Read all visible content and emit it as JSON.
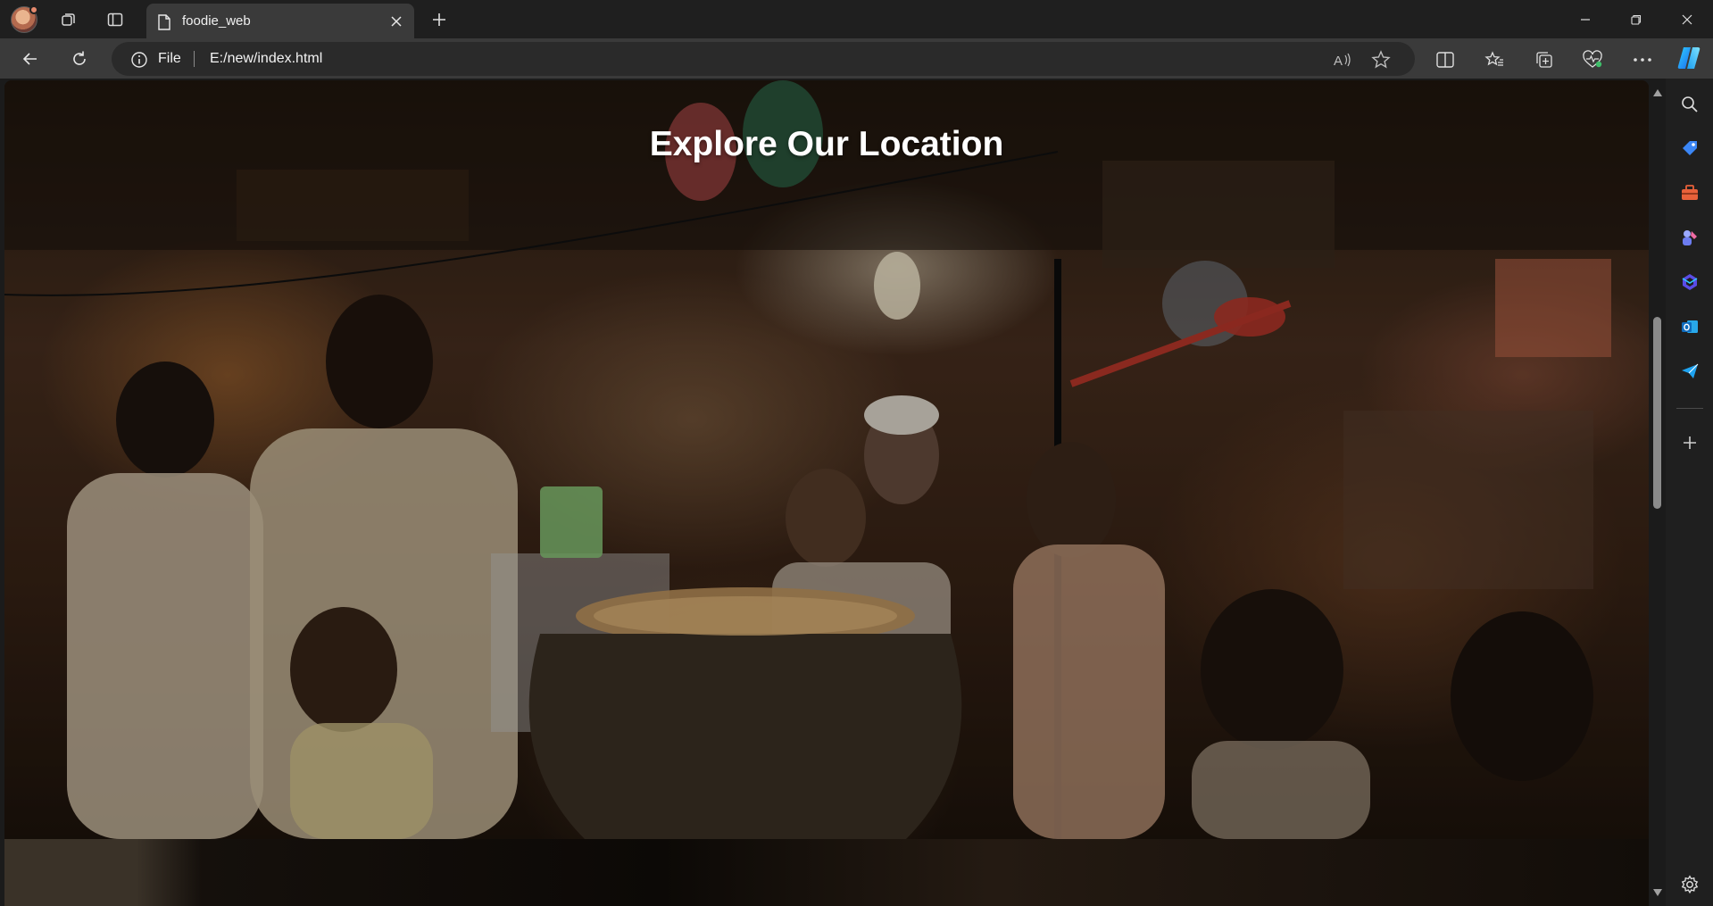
{
  "browser": {
    "tab": {
      "title": "foodie_web"
    },
    "address": {
      "scheme_label": "File",
      "url": "E:/new/index.html"
    }
  },
  "page": {
    "hero": {
      "title": "Explore Our Location"
    }
  },
  "icons": {
    "profile": "profile-avatar",
    "workspaces": "workspaces-icon",
    "vertical_tabs": "tab-actions-icon",
    "tab_page": "page-icon",
    "close": "close-icon",
    "new_tab": "plus-icon",
    "minimize": "minimize-icon",
    "restore": "restore-icon",
    "close_window": "close-window-icon",
    "back": "back-arrow-icon",
    "refresh": "refresh-icon",
    "info": "info-icon",
    "read_aloud": "read-aloud-icon",
    "favorite": "star-icon",
    "split_screen": "split-screen-icon",
    "favorites": "favorites-icon",
    "collections": "collections-icon",
    "browser_essentials": "heart-pulse-icon",
    "more": "more-icon",
    "copilot": "copilot-icon",
    "sidebar": [
      "search-icon",
      "tag-icon",
      "toolbox-icon",
      "games-icon",
      "microsoft365-icon",
      "outlook-icon",
      "send-icon",
      "plus-icon",
      "settings-icon"
    ]
  },
  "colors": {
    "tabstrip_bg": "#1f1f1f",
    "toolbar_bg": "#3a3a3a",
    "title_text": "#ffffff",
    "accent_green": "#3fbf6a"
  }
}
